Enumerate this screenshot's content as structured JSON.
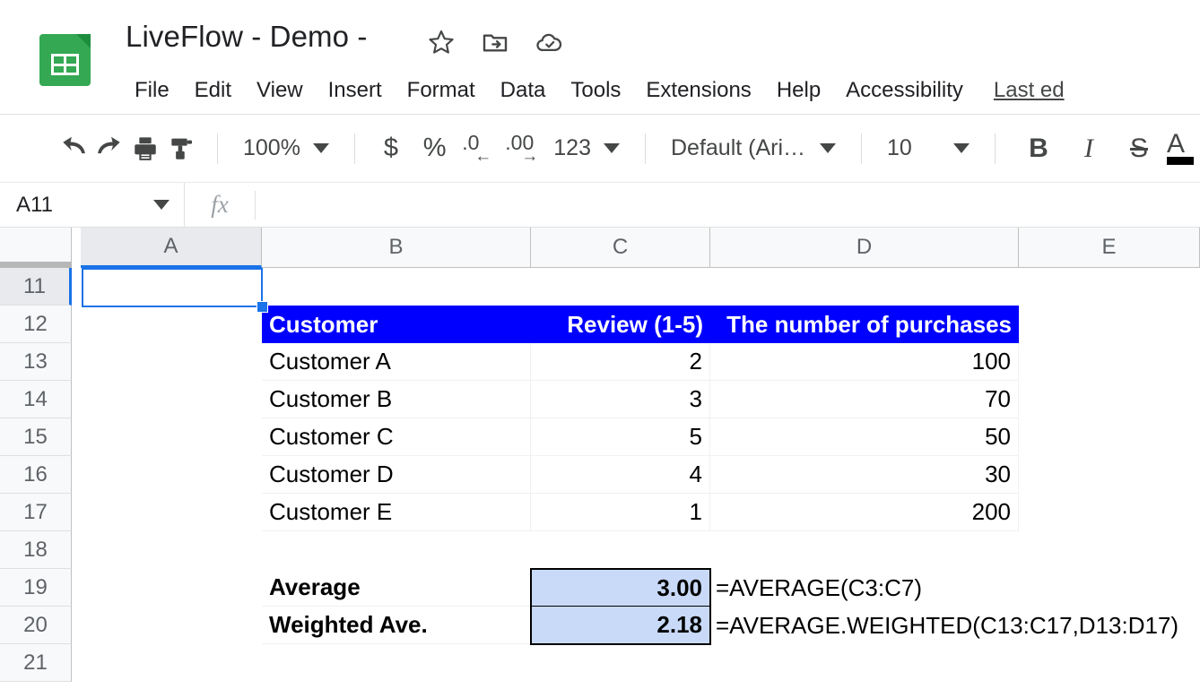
{
  "app": {
    "doc_title": "LiveFlow - Demo -",
    "doc_icon": "sheets-icon",
    "last_edit": "Last ed"
  },
  "title_actions": [
    {
      "name": "star-icon",
      "label": "Star"
    },
    {
      "name": "move-to-folder-icon",
      "label": "Move"
    },
    {
      "name": "cloud-saved-icon",
      "label": "Saved to Drive"
    }
  ],
  "menu": {
    "items": [
      {
        "label": "File"
      },
      {
        "label": "Edit"
      },
      {
        "label": "View"
      },
      {
        "label": "Insert"
      },
      {
        "label": "Format"
      },
      {
        "label": "Data"
      },
      {
        "label": "Tools"
      },
      {
        "label": "Extensions"
      },
      {
        "label": "Help"
      },
      {
        "label": "Accessibility"
      }
    ]
  },
  "toolbar": {
    "undo": "↶",
    "redo": "↷",
    "zoom_value": "100%",
    "currency": "$",
    "percent": "%",
    "decrease_decimal": ".0",
    "decrease_decimal_arrow": "←",
    "increase_decimal": ".00",
    "increase_decimal_arrow": "→",
    "number_format": "123",
    "font_family": "Default (Ari…",
    "font_size": "10",
    "bold": "B",
    "italic": "I",
    "strikethrough": "S",
    "text_color": "A"
  },
  "formula_bar": {
    "name_box": "A11",
    "fx_symbol": "fx",
    "formula_value": ""
  },
  "grid": {
    "columns": [
      "A",
      "B",
      "C",
      "D",
      "E"
    ],
    "selected_column": "A",
    "rows": [
      "11",
      "12",
      "13",
      "14",
      "15",
      "16",
      "17",
      "18",
      "19",
      "20",
      "21"
    ],
    "selected_row": "11",
    "selected_cell": "A11"
  },
  "sheet": {
    "header_row": {
      "customer": "Customer",
      "review": "Review (1-5)",
      "purchases": "The number of purchases"
    },
    "data_rows": [
      {
        "customer": "Customer A",
        "review": "2",
        "purchases": "100"
      },
      {
        "customer": "Customer B",
        "review": "3",
        "purchases": "70"
      },
      {
        "customer": "Customer C",
        "review": "5",
        "purchases": "50"
      },
      {
        "customer": "Customer D",
        "review": "4",
        "purchases": "30"
      },
      {
        "customer": "Customer E",
        "review": "1",
        "purchases": "200"
      }
    ],
    "summary_rows": [
      {
        "label": "Average",
        "value": "3.00",
        "formula": "=AVERAGE(C3:C7)"
      },
      {
        "label": "Weighted Ave.",
        "value": "2.18",
        "formula": "=AVERAGE.WEIGHTED(C13:C17,D13:D17)"
      }
    ]
  },
  "colors": {
    "header_fill": "#0000FF",
    "header_text": "#FFFFFF",
    "value_fill": "#C9DAF8",
    "selection": "#1A73E8",
    "sheets_green": "#34A853"
  }
}
